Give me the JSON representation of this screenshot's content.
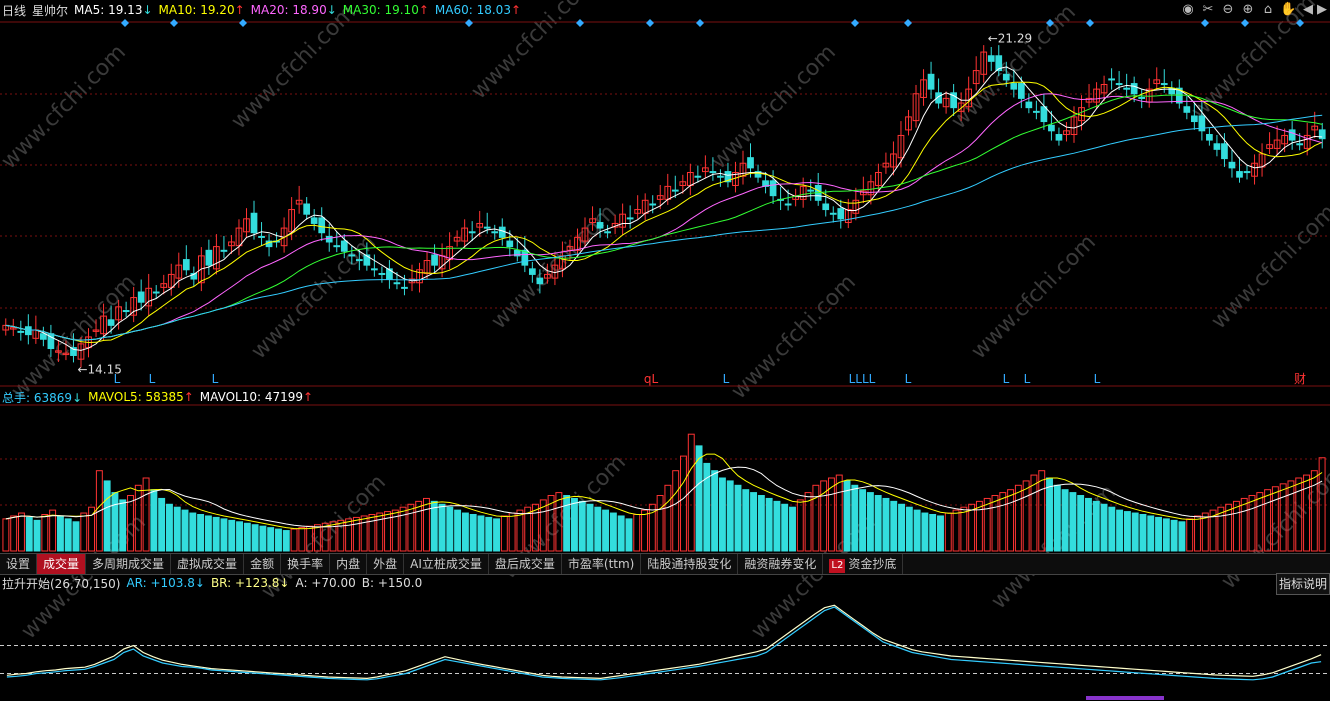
{
  "header": {
    "period": "日线",
    "stock_name": "星帅尔",
    "ma": [
      {
        "label": "MA5",
        "value": "19.13",
        "arrow": "↓",
        "color": "#ffffff"
      },
      {
        "label": "MA10",
        "value": "19.20",
        "arrow": "↑",
        "color": "#ffff00"
      },
      {
        "label": "MA20",
        "value": "18.90",
        "arrow": "↓",
        "color": "#ff66ff"
      },
      {
        "label": "MA30",
        "value": "19.10",
        "arrow": "↑",
        "color": "#33ff33"
      },
      {
        "label": "MA60",
        "value": "18.03",
        "arrow": "↑",
        "color": "#33ccff"
      }
    ]
  },
  "toolbar_icons": [
    "eye-icon",
    "scissors-icon",
    "zoom-out-icon",
    "zoom-in-icon",
    "lock-icon",
    "hand-icon",
    "back-icon",
    "forward-icon"
  ],
  "price_chart": {
    "high_label": "21.29",
    "low_label": "14.15",
    "markers": [
      "L",
      "L",
      "L",
      "qL",
      "L",
      "LLLL",
      "L",
      "L",
      "L",
      "L",
      "财"
    ],
    "watermark": "www.cfchi.com"
  },
  "volume_header": {
    "total": {
      "label": "总手",
      "value": "63869",
      "arrow": "↓",
      "color": "#33ccff"
    },
    "mavol5": {
      "label": "MAVOL5",
      "value": "58385",
      "arrow": "↑",
      "color": "#ffff00"
    },
    "mavol10": {
      "label": "MAVOL10",
      "value": "47199",
      "arrow": "↑",
      "color": "#ffffff"
    }
  },
  "tabs": [
    "设置",
    "成交量",
    "多周期成交量",
    "虚拟成交量",
    "金额",
    "换手率",
    "内盘",
    "外盘",
    "AI立桩成交量",
    "盘后成交量",
    "市盈率(ttm)",
    "陆股通持股变化",
    "融资融券变化",
    "L2",
    "资金抄底"
  ],
  "indicator_header": {
    "name": "拉升开始(26,70,150)",
    "ar": "AR: +103.8↓",
    "br": "BR: +123.8↓",
    "a": "A: +70.00",
    "b": "B: +150.0"
  },
  "explain_button": "指标说明",
  "colors": {
    "up": "#ff3333",
    "down": "#33dddd",
    "ma5": "#ffffff",
    "ma10": "#ffff00",
    "ma20": "#ff66ff",
    "ma30": "#33ff33",
    "ma60": "#33ccff",
    "grid": "#7a1010"
  },
  "chart_data": {
    "type": "candlestick",
    "price_range": [
      14.15,
      21.29
    ],
    "closes": [
      15.1,
      15.05,
      14.95,
      14.9,
      15.0,
      14.8,
      14.6,
      14.55,
      14.5,
      14.45,
      14.7,
      14.85,
      15.0,
      15.3,
      15.1,
      15.5,
      15.4,
      15.7,
      15.6,
      15.9,
      15.8,
      16.0,
      16.2,
      16.4,
      16.3,
      16.1,
      16.6,
      16.4,
      16.8,
      16.7,
      16.9,
      17.2,
      17.4,
      17.1,
      17.0,
      16.8,
      16.9,
      17.2,
      17.6,
      17.8,
      17.5,
      17.3,
      17.1,
      16.9,
      16.8,
      16.7,
      16.6,
      16.5,
      16.4,
      16.3,
      16.2,
      16.1,
      16.0,
      15.9,
      16.1,
      16.3,
      16.5,
      16.4,
      16.6,
      16.8,
      17.0,
      17.2,
      17.1,
      17.3,
      17.2,
      17.1,
      17.0,
      16.8,
      16.6,
      16.4,
      16.2,
      16.0,
      16.2,
      16.4,
      16.6,
      16.8,
      17.0,
      17.2,
      17.4,
      17.2,
      17.1,
      17.3,
      17.5,
      17.4,
      17.6,
      17.8,
      17.7,
      17.9,
      18.1,
      18.0,
      18.2,
      18.4,
      18.3,
      18.5,
      18.4,
      18.3,
      18.2,
      18.4,
      18.6,
      18.5,
      18.3,
      18.1,
      17.9,
      17.8,
      17.7,
      17.9,
      18.1,
      18.0,
      17.8,
      17.6,
      17.5,
      17.4,
      17.6,
      17.8,
      18.0,
      18.2,
      18.4,
      18.6,
      18.8,
      19.2,
      19.6,
      20.1,
      20.4,
      20.2,
      19.9,
      20.0,
      19.8,
      19.9,
      20.2,
      20.6,
      21.0,
      20.8,
      20.6,
      20.4,
      20.2,
      20.0,
      19.8,
      19.7,
      19.5,
      19.3,
      19.1,
      19.3,
      19.6,
      19.8,
      20.0,
      20.2,
      20.3,
      20.4,
      20.3,
      20.2,
      20.1,
      20.0,
      20.2,
      20.4,
      20.3,
      20.1,
      19.9,
      19.7,
      19.5,
      19.3,
      19.1,
      18.9,
      18.7,
      18.5,
      18.3,
      18.4,
      18.6,
      18.8,
      19.0,
      19.1,
      19.2,
      19.1,
      19.0,
      19.2,
      19.4,
      19.13
    ],
    "volume_range": [
      0,
      100000
    ],
    "volumes": [
      22000,
      24000,
      26000,
      23000,
      21000,
      25000,
      28000,
      24000,
      22000,
      20000,
      26000,
      30000,
      55000,
      48000,
      40000,
      35000,
      38000,
      45000,
      50000,
      42000,
      36000,
      32000,
      30000,
      28000,
      26000,
      25000,
      24000,
      23000,
      22000,
      21000,
      20000,
      19000,
      18000,
      17000,
      16000,
      15000,
      14000,
      15000,
      16000,
      17000,
      18000,
      19000,
      20000,
      21000,
      22000,
      23000,
      24000,
      25000,
      26000,
      27000,
      28000,
      30000,
      32000,
      34000,
      36000,
      34000,
      32000,
      30000,
      28000,
      26000,
      25000,
      24000,
      23000,
      22000,
      24000,
      26000,
      28000,
      30000,
      32000,
      35000,
      38000,
      40000,
      38000,
      36000,
      34000,
      32000,
      30000,
      28000,
      26000,
      24000,
      22000,
      25000,
      28000,
      32000,
      38000,
      45000,
      55000,
      65000,
      80000,
      72000,
      60000,
      55000,
      50000,
      48000,
      45000,
      42000,
      40000,
      38000,
      36000,
      34000,
      32000,
      30000,
      35000,
      40000,
      45000,
      48000,
      50000,
      52000,
      48000,
      45000,
      42000,
      40000,
      38000,
      36000,
      34000,
      32000,
      30000,
      28000,
      26000,
      25000,
      24000,
      26000,
      28000,
      30000,
      32000,
      34000,
      36000,
      38000,
      40000,
      42000,
      45000,
      48000,
      52000,
      55000,
      50000,
      45000,
      42000,
      40000,
      38000,
      36000,
      34000,
      32000,
      30000,
      28000,
      27000,
      26000,
      25000,
      24000,
      23000,
      22000,
      21000,
      20000,
      22000,
      24000,
      26000,
      28000,
      30000,
      32000,
      34000,
      36000,
      38000,
      40000,
      42000,
      44000,
      46000,
      48000,
      50000,
      52000,
      55000,
      63869
    ],
    "ar_range": [
      0,
      300
    ],
    "ar": [
      60,
      62,
      65,
      70,
      72,
      75,
      78,
      80,
      82,
      90,
      100,
      110,
      130,
      140,
      120,
      110,
      100,
      95,
      90,
      88,
      85,
      80,
      78,
      76,
      74,
      72,
      70,
      68,
      66,
      64,
      62,
      60,
      58,
      56,
      55,
      54,
      53,
      52,
      55,
      60,
      65,
      70,
      80,
      90,
      100,
      110,
      105,
      100,
      95,
      90,
      85,
      80,
      75,
      70,
      65,
      60,
      58,
      56,
      55,
      54,
      53,
      52,
      55,
      58,
      62,
      66,
      70,
      74,
      78,
      82,
      86,
      90,
      95,
      100,
      105,
      110,
      115,
      120,
      130,
      150,
      170,
      190,
      210,
      230,
      250,
      260,
      240,
      220,
      200,
      180,
      160,
      150,
      140,
      130,
      125,
      120,
      115,
      110,
      108,
      106,
      104,
      102,
      100,
      98,
      96,
      94,
      92,
      90,
      88,
      86,
      84,
      82,
      80,
      78,
      76,
      74,
      72,
      70,
      68,
      66,
      64,
      62,
      60,
      58,
      56,
      55,
      54,
      53,
      52,
      55,
      60,
      70,
      80,
      90,
      100,
      103.8
    ],
    "br": [
      65,
      68,
      70,
      75,
      78,
      80,
      84,
      86,
      88,
      96,
      108,
      120,
      140,
      150,
      130,
      118,
      108,
      102,
      96,
      92,
      88,
      84,
      82,
      80,
      78,
      76,
      74,
      72,
      70,
      68,
      66,
      64,
      62,
      60,
      59,
      58,
      57,
      56,
      60,
      66,
      72,
      78,
      88,
      98,
      108,
      118,
      112,
      106,
      100,
      95,
      90,
      85,
      80,
      75,
      70,
      65,
      62,
      60,
      59,
      58,
      57,
      56,
      60,
      64,
      68,
      72,
      76,
      80,
      84,
      88,
      92,
      96,
      102,
      108,
      114,
      120,
      126,
      132,
      140,
      160,
      180,
      200,
      220,
      240,
      258,
      265,
      245,
      225,
      205,
      185,
      168,
      158,
      148,
      138,
      132,
      128,
      124,
      120,
      118,
      116,
      114,
      112,
      110,
      108,
      106,
      104,
      102,
      100,
      98,
      96,
      94,
      92,
      90,
      88,
      86,
      84,
      82,
      80,
      78,
      76,
      74,
      72,
      70,
      68,
      66,
      65,
      64,
      63,
      62,
      66,
      72,
      82,
      92,
      102,
      112,
      123.8
    ],
    "ar_levels": {
      "A": 70,
      "B": 150
    }
  }
}
